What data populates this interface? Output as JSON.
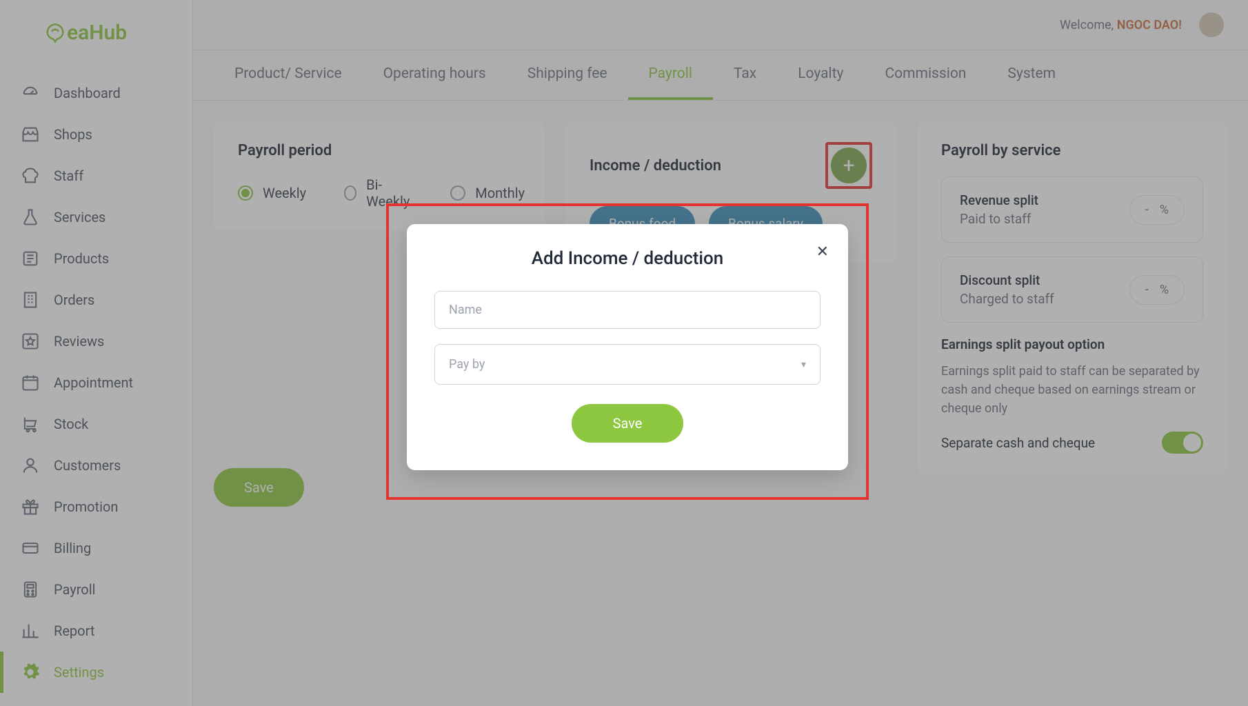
{
  "brand": {
    "name": "eaHub"
  },
  "header": {
    "welcome": "Welcome, ",
    "user": "NGOC DAO!"
  },
  "sidebar": {
    "items": [
      {
        "label": "Dashboard"
      },
      {
        "label": "Shops"
      },
      {
        "label": "Staff"
      },
      {
        "label": "Services"
      },
      {
        "label": "Products"
      },
      {
        "label": "Orders"
      },
      {
        "label": "Reviews"
      },
      {
        "label": "Appointment"
      },
      {
        "label": "Stock"
      },
      {
        "label": "Customers"
      },
      {
        "label": "Promotion"
      },
      {
        "label": "Billing"
      },
      {
        "label": "Payroll"
      },
      {
        "label": "Report"
      },
      {
        "label": "Settings"
      }
    ]
  },
  "tabs": {
    "items": [
      {
        "label": "Product/ Service"
      },
      {
        "label": "Operating hours"
      },
      {
        "label": "Shipping fee"
      },
      {
        "label": "Payroll"
      },
      {
        "label": "Tax"
      },
      {
        "label": "Loyalty"
      },
      {
        "label": "Commission"
      },
      {
        "label": "System"
      }
    ]
  },
  "payroll_period": {
    "title": "Payroll period",
    "options": {
      "weekly": "Weekly",
      "biweekly": "Bi-Weekly",
      "monthly": "Monthly"
    }
  },
  "income": {
    "title": "Income / deduction",
    "chips": {
      "bonus_food": "Bonus food",
      "bonus_salary": "Bonus salary"
    }
  },
  "service": {
    "title": "Payroll by service",
    "revenue_t": "Revenue split",
    "revenue_s": "Paid to staff",
    "discount_t": "Discount split",
    "discount_s": "Charged to staff",
    "dash": "-",
    "pct": "%",
    "earn_heading": "Earnings split payout option",
    "earn_desc": "Earnings split paid to staff can be separated by cash and cheque based on earnings stream or cheque only",
    "toggle_label": "Separate cash and cheque"
  },
  "buttons": {
    "save": "Save"
  },
  "modal": {
    "title": "Add Income / deduction",
    "name_placeholder": "Name",
    "payby_placeholder": "Pay by",
    "save": "Save"
  }
}
